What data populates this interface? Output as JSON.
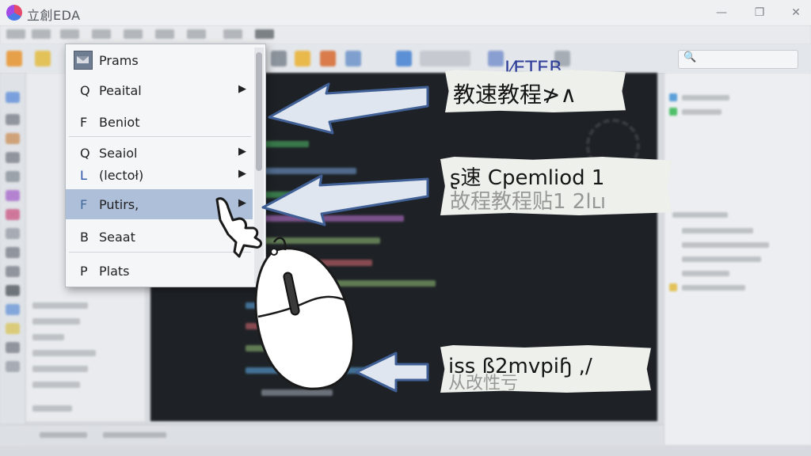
{
  "app": {
    "title": "立創EDA"
  },
  "toolbar": {
    "search_icon": "🔍"
  },
  "context_menu": {
    "items": [
      {
        "hotkey": "",
        "label": "Prams",
        "submenu": false,
        "icon": "mail-icon"
      },
      {
        "hotkey": "Q",
        "label": "Peaital",
        "submenu": true
      },
      {
        "hotkey": "F",
        "label": "Beniot",
        "submenu": false
      },
      {
        "hotkey": "Q",
        "label": "Seaiol",
        "submenu": true
      },
      {
        "hotkey": "L",
        "label": "(lectoł)",
        "submenu": true
      },
      {
        "hotkey": "F",
        "label": "Putirs,",
        "submenu": true,
        "selected": true
      },
      {
        "hotkey": "B",
        "label": "Seaat",
        "submenu": false
      },
      {
        "hotkey": "P",
        "label": "Plats",
        "submenu": false
      }
    ],
    "submenu_arrow": "▶"
  },
  "annotations": {
    "top_caption": "I⁄ETEB",
    "callout1": {
      "text": "教速教程≯∧"
    },
    "callout2": {
      "text": "ʂ速 Cpemliod  1",
      "ghost": "故程教程贴1 2lւı"
    },
    "callout3": {
      "text": "iss ß2mvpiɧ ,/",
      "ghost": "从改性亏"
    }
  },
  "colors": {
    "accent": "#2b52a8",
    "selection": "#aebfd9",
    "arrow_fill": "#dfe6f0",
    "arrow_stroke": "#3f5f95"
  }
}
